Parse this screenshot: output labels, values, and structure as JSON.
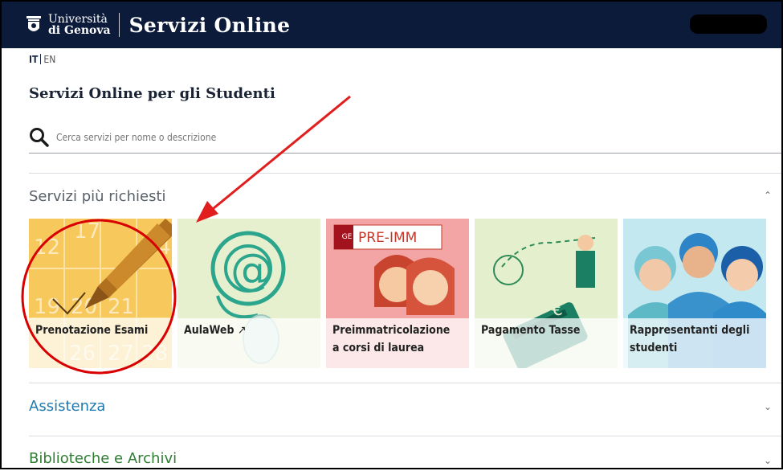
{
  "header": {
    "university_line1": "Università",
    "university_line2": "di Genova",
    "app_title": "Servizi Online"
  },
  "language": {
    "current": "IT",
    "other": "EN"
  },
  "page": {
    "title": "Servizi Online per gli Studenti"
  },
  "search": {
    "placeholder": "Cerca servizi per nome o descrizione"
  },
  "sections": {
    "popular": "Servizi più richiesti",
    "assistance": "Assistenza",
    "libraries": "Biblioteche e Archivi"
  },
  "tiles": [
    {
      "label": "Prenotazione Esami",
      "icon": "calendar-pen-icon"
    },
    {
      "label": "AulaWeb",
      "icon": "at-mouse-icon",
      "external": true
    },
    {
      "label_line1": "Preimmatricolazione",
      "label_line2": "a corsi di laurea",
      "badge": "PRE-IMM",
      "badge_sub": "GE"
    },
    {
      "label": "Pagamento Tasse",
      "icon": "credit-card-icon"
    },
    {
      "label_line1": "Rappresentanti degli",
      "label_line2": "studenti",
      "icon": "people-icon"
    }
  ],
  "annotation_colors": {
    "arrow": "#e11d1d",
    "circle": "#d80000"
  }
}
